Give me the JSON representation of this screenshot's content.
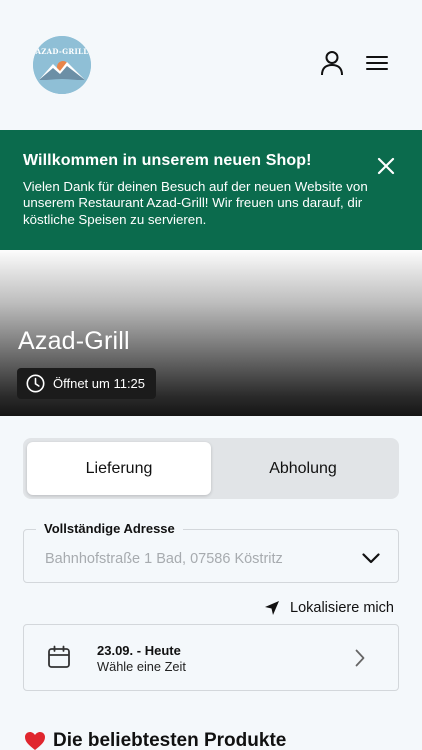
{
  "header": {
    "logo_text": "AZAD-GRILL",
    "account_icon": "user-icon",
    "menu_icon": "hamburger-menu-icon"
  },
  "banner": {
    "title": "Willkommen in unserem neuen Shop!",
    "text": "Vielen Dank für deinen Besuch auf der neuen Website von unserem Restaurant Azad-Grill! Wir freuen uns darauf, dir köstliche Speisen zu servieren.",
    "close_icon": "close-icon",
    "color": "#0b6b4d"
  },
  "hero": {
    "title": "Azad-Grill",
    "opening_text": "Öffnet um 11:25",
    "clock_icon": "clock-icon"
  },
  "order_type": {
    "options": [
      "Lieferung",
      "Abholung"
    ],
    "selected": "Lieferung"
  },
  "address": {
    "label": "Vollständige Adresse",
    "placeholder": "Bahnhofstraße 1 Bad, 07586 Köstritz",
    "chevron_icon": "chevron-down-icon"
  },
  "locate": {
    "label": "Lokalisiere mich",
    "icon": "location-arrow-icon"
  },
  "time": {
    "date": "23.09. - Heute",
    "hint": "Wähle eine Zeit",
    "calendar_icon": "calendar-icon",
    "chevron_icon": "chevron-right-icon"
  },
  "products": {
    "heading": "Die beliebtesten Produkte",
    "icon": "heart-icon"
  }
}
